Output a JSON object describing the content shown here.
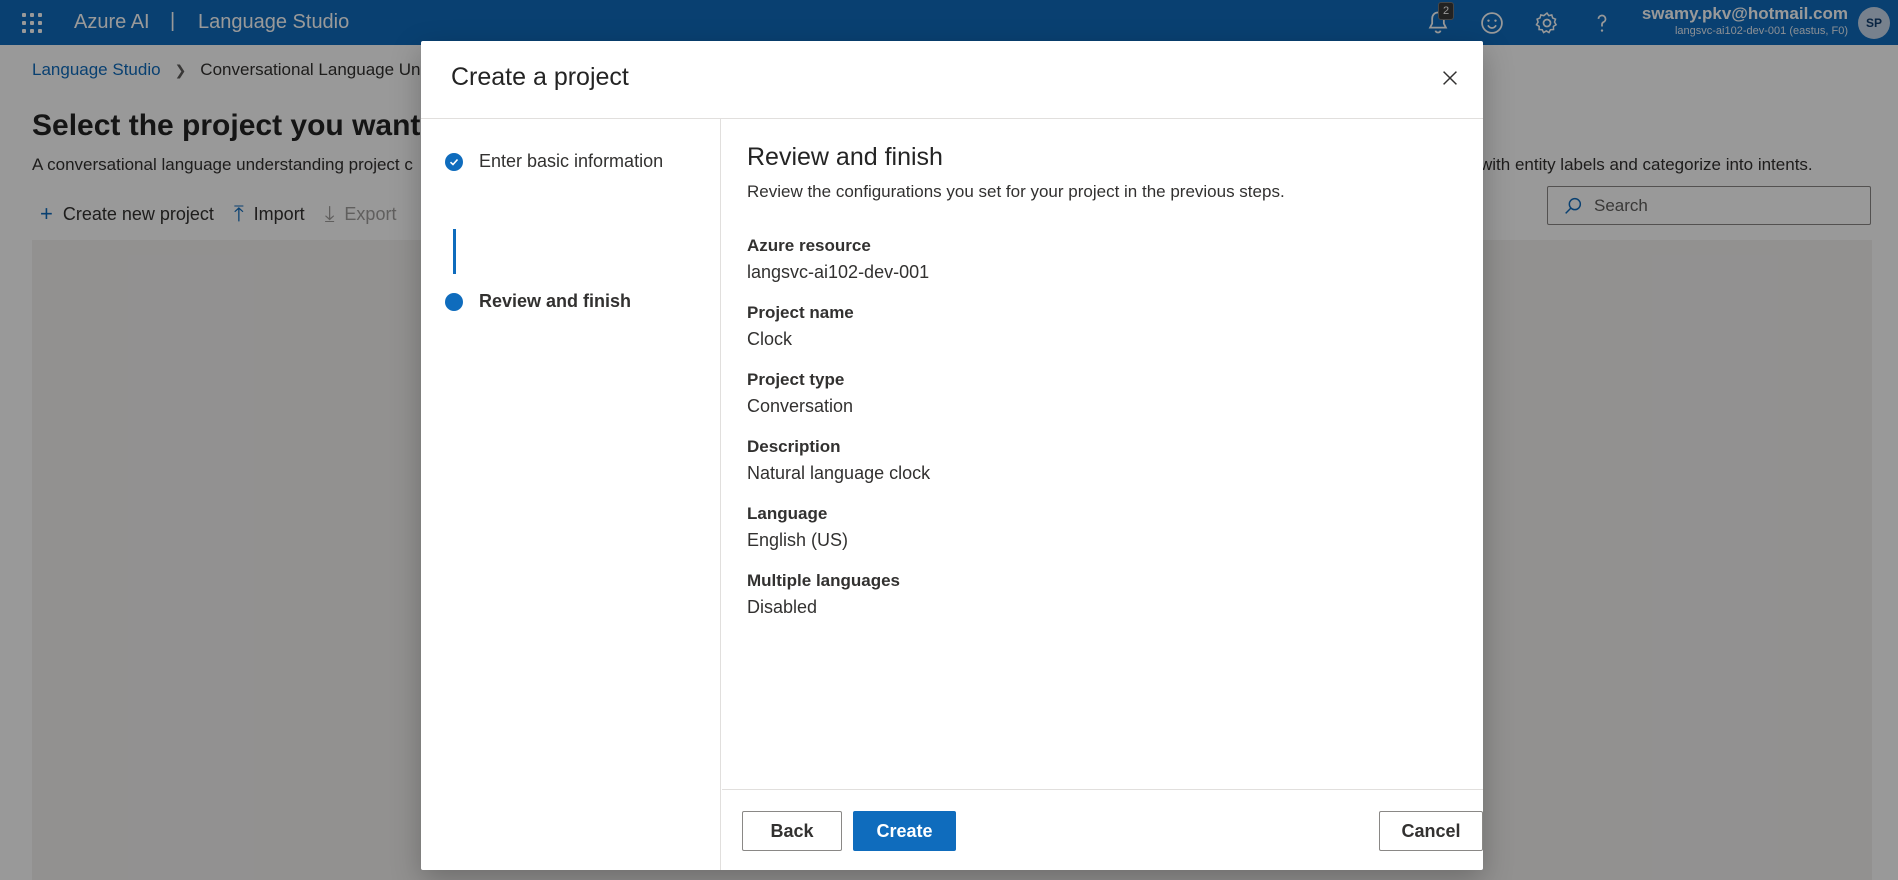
{
  "topbar": {
    "brand": "Azure AI",
    "separator": "|",
    "product": "Language Studio",
    "notification_count": "2",
    "user_email": "swamy.pkv@hotmail.com",
    "user_resource": "langsvc-ai102-dev-001 (eastus, F0)",
    "avatar_initials": "SP"
  },
  "breadcrumb": {
    "root": "Language Studio",
    "current": "Conversational Language Und"
  },
  "page": {
    "title": "Select the project you want t",
    "description_left": "A conversational language understanding project c",
    "description_right": "with entity labels and categorize into intents.",
    "commands": {
      "create": "Create new project",
      "import": "Import",
      "export": "Export"
    },
    "search_placeholder": "Search"
  },
  "dialog": {
    "title": "Create a project",
    "steps": [
      {
        "label": "Enter basic information",
        "state": "completed"
      },
      {
        "label": "Review and finish",
        "state": "current"
      }
    ],
    "heading": "Review and finish",
    "subheading": "Review the configurations you set for your project in the previous steps.",
    "fields": [
      {
        "label": "Azure resource",
        "value": "langsvc-ai102-dev-001"
      },
      {
        "label": "Project name",
        "value": "Clock"
      },
      {
        "label": "Project type",
        "value": "Conversation"
      },
      {
        "label": "Description",
        "value": "Natural language clock"
      },
      {
        "label": "Language",
        "value": "English (US)"
      },
      {
        "label": "Multiple languages",
        "value": "Disabled"
      }
    ],
    "buttons": {
      "back": "Back",
      "create": "Create",
      "cancel": "Cancel"
    }
  },
  "colors": {
    "accent": "#0f6cbd",
    "overlay": "rgba(0,0,0,0.4)"
  }
}
